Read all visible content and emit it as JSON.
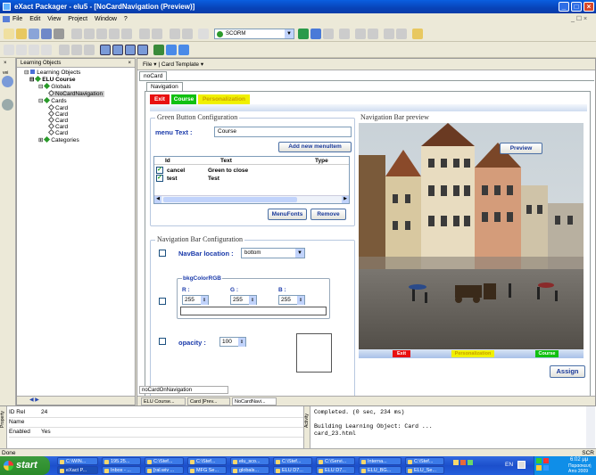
{
  "window": {
    "title": "eXact Packager - elu5 - [NoCardNavigation (Preview)]"
  },
  "menu": [
    "File",
    "Edit",
    "View",
    "Project",
    "Window",
    "?"
  ],
  "toolbar": {
    "scorm_combo": "SCORM"
  },
  "learning_objects": {
    "panel_title": "Learning Objects",
    "tree": [
      {
        "label": "Learning Objects"
      },
      {
        "label": "ELU Course"
      },
      {
        "label": "Globals"
      },
      {
        "label": "NoCardNavigation"
      },
      {
        "label": "Cards"
      },
      {
        "label": "Card"
      },
      {
        "label": "Card"
      },
      {
        "label": "Card"
      },
      {
        "label": "Card"
      },
      {
        "label": "Card"
      },
      {
        "label": "Categories"
      }
    ]
  },
  "editor": {
    "file_menu": "File",
    "card_template_menu": "Card Template",
    "doc_tab": "noCard",
    "navigation_tab": "Navigation",
    "nav_tabs": [
      {
        "label": "Exit",
        "color": "#e81010"
      },
      {
        "label": "Course",
        "color": "#10c010"
      },
      {
        "label": "Personalization",
        "color": "#f0f000"
      }
    ],
    "green_button_config": {
      "legend": "Green Button Configuration",
      "menu_text_label": "menu Text :",
      "menu_text_value": "Course",
      "add_menu_item_button": "Add new menuItem",
      "table_headers": [
        "Id",
        "Text",
        "Type"
      ],
      "rows": [
        {
          "checked": true,
          "id": "cancel",
          "text": "Green to close",
          "type": ""
        },
        {
          "checked": true,
          "id": "test",
          "text": "Test",
          "type": ""
        }
      ],
      "menu_fonts_button": "MenuFonts",
      "remove_button": "Remove"
    },
    "nav_bar_config": {
      "legend": "Navigation Bar Configuration",
      "location_label": "NavBar location :",
      "location_value": "bottom",
      "bkg_color_label": "bkgColorRGB",
      "r_label": "R :",
      "g_label": "G :",
      "b_label": "B :",
      "r_value": "255",
      "g_value": "255",
      "b_value": "255",
      "opacity_label": "opacity :",
      "opacity_value": "100"
    },
    "preview": {
      "legend": "Navigation Bar preview",
      "preview_button": "Preview",
      "bar_buttons": [
        {
          "label": "Exit",
          "color": "#e81010"
        },
        {
          "label": "Personalization",
          "color": "#f0f000"
        },
        {
          "label": "Course",
          "color": "#10c010"
        }
      ]
    },
    "assign_button": "Assign",
    "bottom_tab": "noCardOnNavigation",
    "doc_tabs": [
      "ELU Course...",
      "Card [Prev...",
      "NoCardNavi..."
    ]
  },
  "properties": {
    "rows": [
      {
        "name": "ID Rel",
        "value": "24"
      },
      {
        "name": "Name",
        "value": ""
      },
      {
        "name": "Enabled",
        "value": "Yes"
      }
    ],
    "side_label": "Property"
  },
  "activity": {
    "side_label": "Activity",
    "lines": [
      "Completed. (0 sec, 234 ms)",
      "",
      "Building Learning Object: Card ...",
      "card_23.html"
    ]
  },
  "status": {
    "text": "Done",
    "right": "SCR"
  },
  "taskbar": {
    "start": "start",
    "row1": [
      "C:\\WIN...",
      "195.25...",
      "C:\\Stef...",
      "C:\\Stef...",
      "elu_sco...",
      "C:\\Stef...",
      "C:\\Servi...",
      "Interna...",
      "C:\\Stef..."
    ],
    "row2": [
      "eXact P...",
      "Inbox - ...",
      "[ral.wiv ...",
      "MFG Se...",
      "globals...",
      "ELU D7...",
      "ELU D7...",
      "ELU_BG...",
      "ELU_Se..."
    ],
    "lang": "EN",
    "clock": "6:02 μμ",
    "tray_text_1": "Παρασκευή",
    "tray_text_2": "Απο 2009"
  }
}
